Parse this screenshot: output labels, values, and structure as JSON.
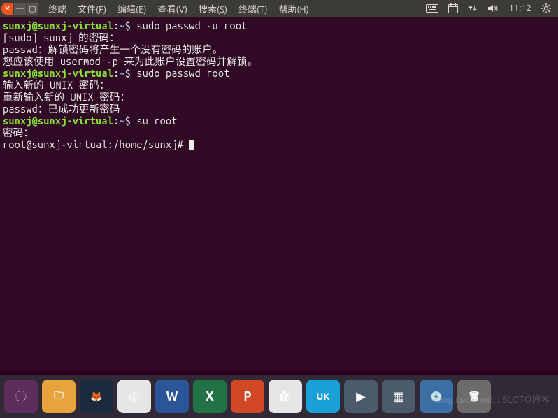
{
  "menubar": {
    "items": [
      "终端",
      "文件(F)",
      "编辑(E)",
      "查看(V)",
      "搜索(S)",
      "终端(T)",
      "帮助(H)"
    ],
    "time": "11:12"
  },
  "terminal": {
    "lines": [
      {
        "prompt_user": "sunxj@sunxj-virtual",
        "prompt_path": "~",
        "prompt_sym": "$",
        "cmd": "sudo passwd -u root"
      },
      {
        "text": "[sudo] sunxj 的密码："
      },
      {
        "text": "passwd：解锁密码将产生一个没有密码的账户。"
      },
      {
        "text": "您应该使用 usermod -p 来为此账户设置密码并解锁。"
      },
      {
        "prompt_user": "sunxj@sunxj-virtual",
        "prompt_path": "~",
        "prompt_sym": "$",
        "cmd": "sudo passwd root"
      },
      {
        "text": "输入新的 UNIX 密码："
      },
      {
        "text": "重新输入新的 UNIX 密码："
      },
      {
        "text": "passwd：已成功更新密码"
      },
      {
        "prompt_user": "sunxj@sunxj-virtual",
        "prompt_path": "~",
        "prompt_sym": "$",
        "cmd": "su root"
      },
      {
        "text": "密码："
      },
      {
        "root_prompt": "root@sunxj-virtual:/home/sunxj#",
        "cursor": true
      }
    ]
  },
  "dock": {
    "apps": [
      {
        "name": "ubuntu-launcher",
        "bg": "#5d2d5d",
        "glyph": "◌"
      },
      {
        "name": "files",
        "bg": "#e8a33d",
        "glyph": "🗀"
      },
      {
        "name": "firefox",
        "bg": "#1b2a3d",
        "glyph": "🦊"
      },
      {
        "name": "chromium",
        "bg": "#e6e6e6",
        "glyph": "◎"
      },
      {
        "name": "word",
        "bg": "#2b579a",
        "glyph": "W"
      },
      {
        "name": "excel",
        "bg": "#217346",
        "glyph": "X"
      },
      {
        "name": "powerpoint",
        "bg": "#d24726",
        "glyph": "P"
      },
      {
        "name": "software-center",
        "bg": "#e6e6e6",
        "glyph": "🛍"
      },
      {
        "name": "ubuntu-kylin",
        "bg": "#1aa0d8",
        "glyph": "UK"
      },
      {
        "name": "player",
        "bg": "#4b5b6b",
        "glyph": "▶"
      },
      {
        "name": "workspace",
        "bg": "#4b5b6b",
        "glyph": "▦"
      },
      {
        "name": "brasero",
        "bg": "#3b6ea5",
        "glyph": "💿"
      },
      {
        "name": "trash",
        "bg": "#6b6b6b",
        "glyph": "🗑"
      }
    ]
  },
  "watermark": "blog.csdn.net/... 51CTO博客"
}
